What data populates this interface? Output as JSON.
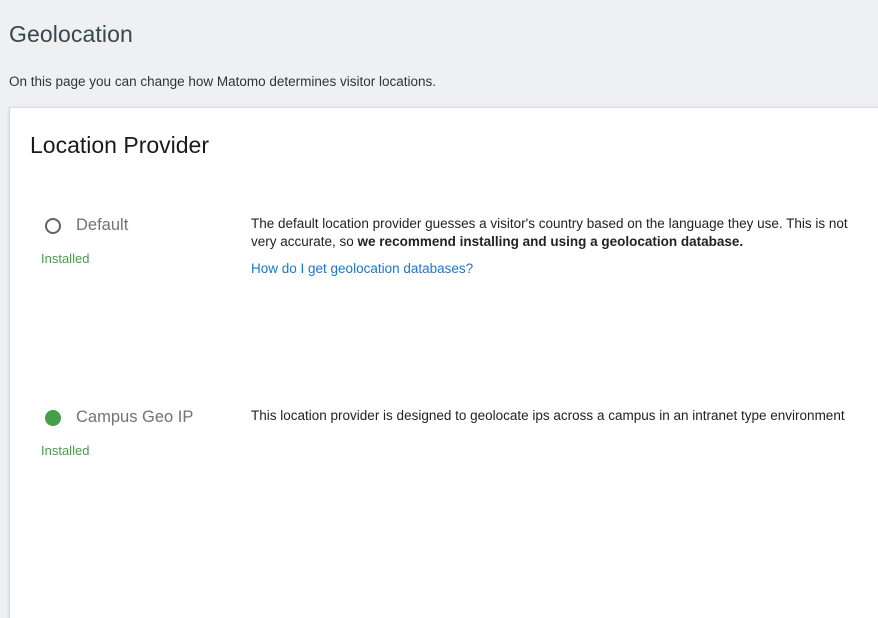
{
  "header": {
    "title": "Geolocation",
    "intro": "On this page you can change how Matomo determines visitor locations."
  },
  "location_provider": {
    "title": "Location Provider",
    "providers": [
      {
        "label": "Default",
        "selected": false,
        "status": "Installed",
        "description_normal": "The default location provider guesses a visitor's country based on the language they use. This is not very accurate, so ",
        "description_bold": "we recommend installing and using a geolocation database.",
        "link_text": "How do I get geolocation databases?"
      },
      {
        "label": "Campus Geo IP",
        "selected": true,
        "status": "Installed",
        "description_normal": "This location provider is designed to geolocate ips across a campus in an intranet type environment"
      }
    ]
  },
  "colors": {
    "status_green": "#43a047",
    "link_blue": "#1976d2",
    "page_bg": "#eff0f1"
  }
}
